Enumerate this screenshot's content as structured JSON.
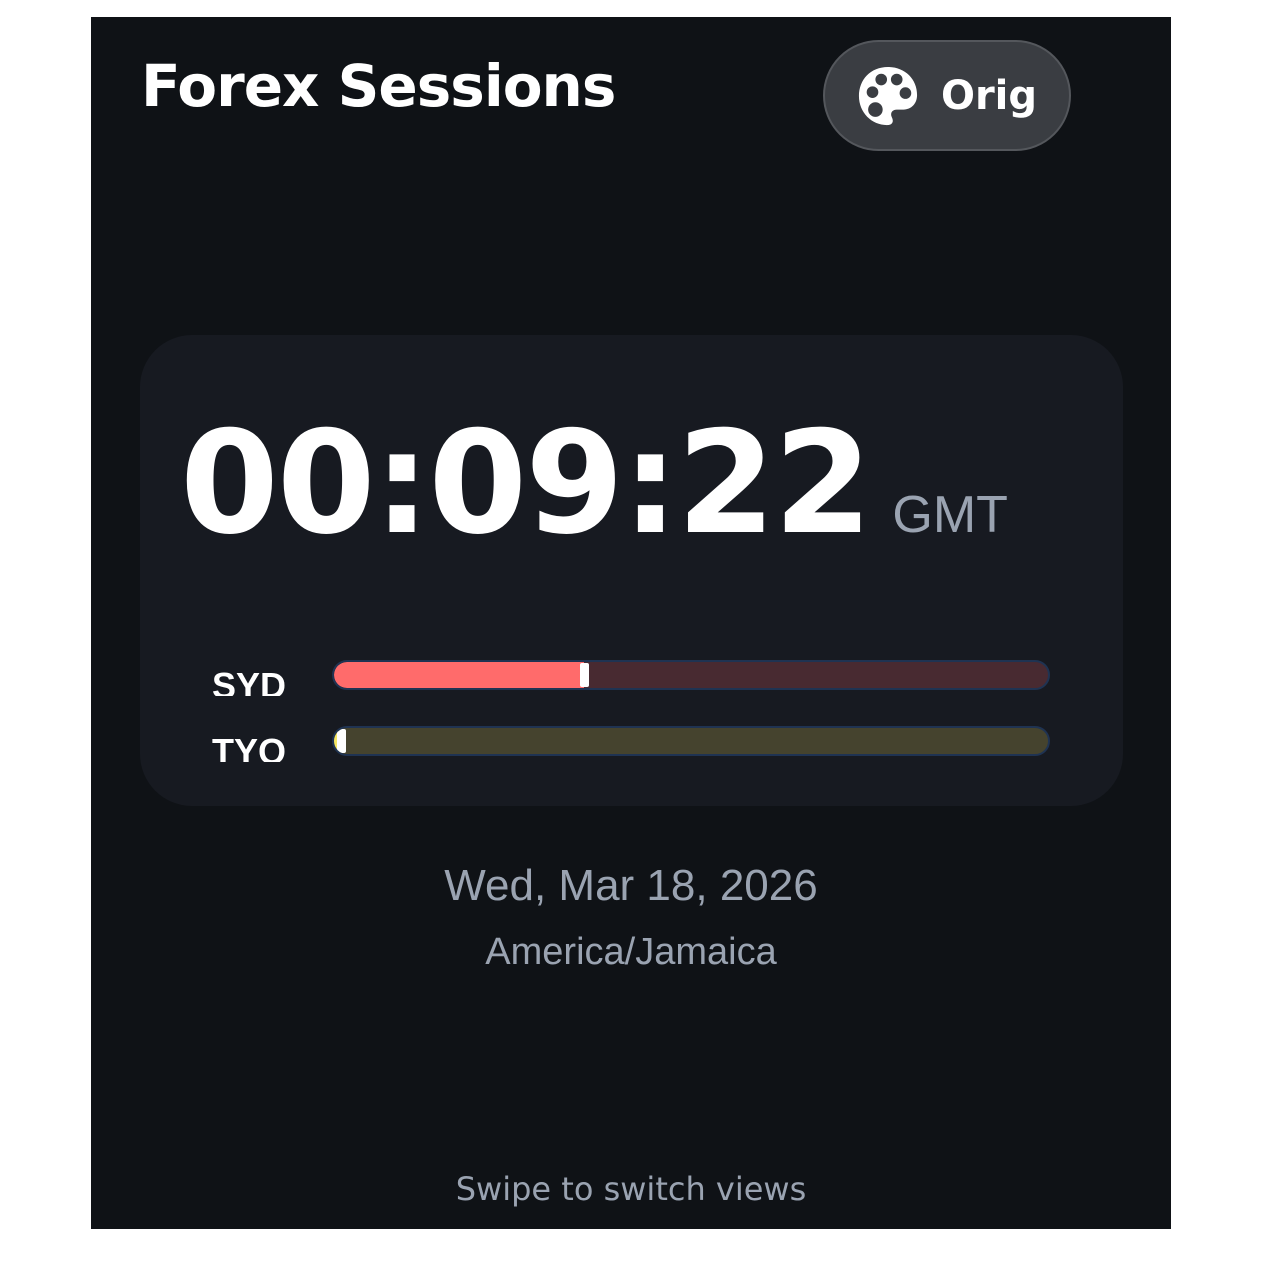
{
  "header": {
    "title": "Forex Sessions",
    "theme_button": {
      "label": "Orig",
      "icon": "palette-icon"
    }
  },
  "clock": {
    "time": "00:09:22",
    "timezone": "GMT"
  },
  "sessions": [
    {
      "code": "SYD",
      "progress": 0.35,
      "active_color": "#ff6b6b",
      "track_color": "#482a31"
    },
    {
      "code": "TYO",
      "progress": 0.01,
      "active_color": "#f5e663",
      "track_color": "#45432e"
    }
  ],
  "date": {
    "date_text": "Wed, Mar 18, 2026",
    "zone_text": "America/Jamaica"
  },
  "footer": {
    "hint": "Swipe to switch views"
  },
  "colors": {
    "background": "#0f1216",
    "card": "#171a21",
    "muted_text": "#9aa3b1",
    "button_bg": "#3a3d42"
  }
}
